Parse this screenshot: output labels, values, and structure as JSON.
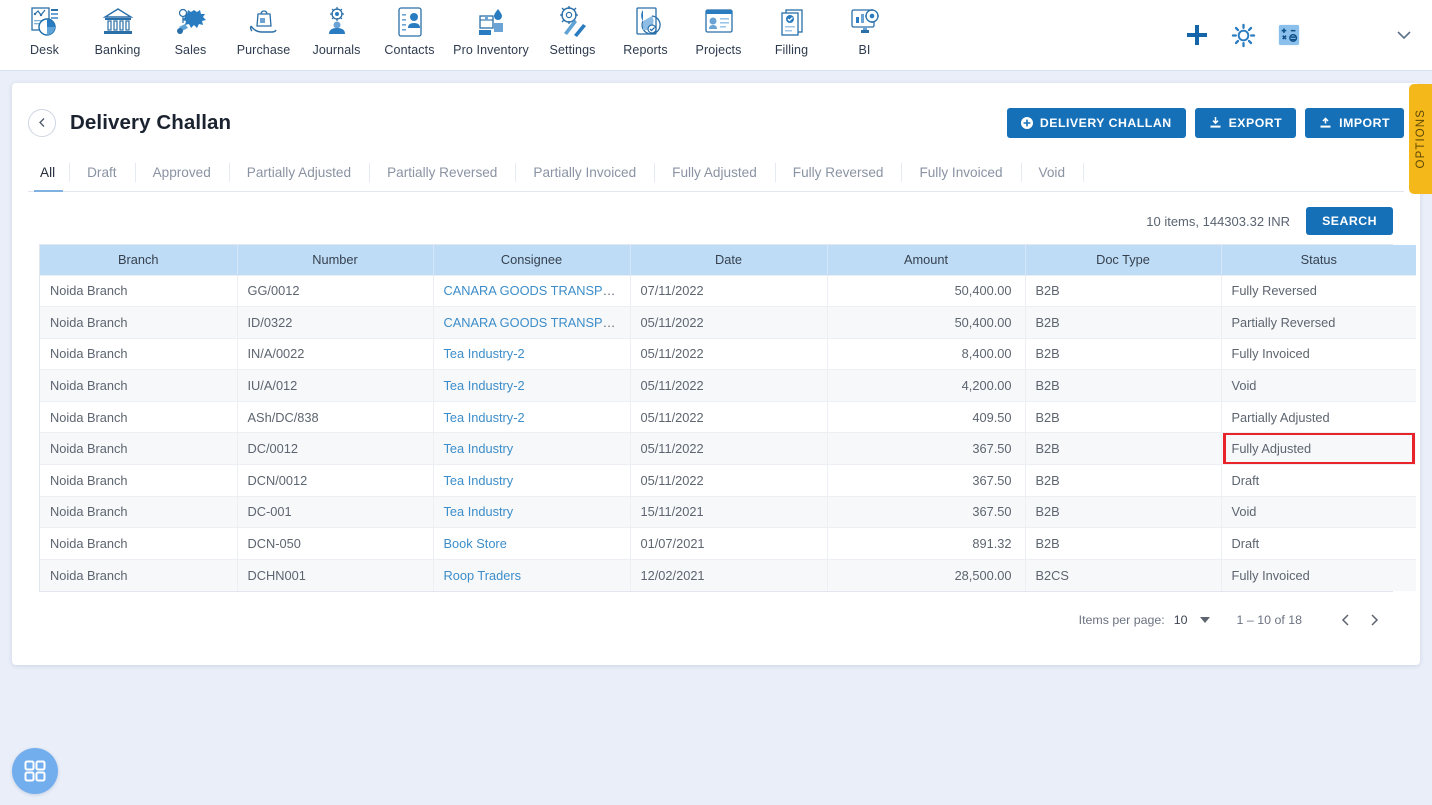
{
  "topnav": {
    "items": [
      {
        "label": "Desk",
        "icon": "desk-dashboard-icon"
      },
      {
        "label": "Banking",
        "icon": "bank-icon"
      },
      {
        "label": "Sales",
        "icon": "sales-icon"
      },
      {
        "label": "Purchase",
        "icon": "purchase-icon"
      },
      {
        "label": "Journals",
        "icon": "journals-icon"
      },
      {
        "label": "Contacts",
        "icon": "contacts-icon"
      },
      {
        "label": "Pro Inventory",
        "icon": "inventory-icon"
      },
      {
        "label": "Settings",
        "icon": "settings-tools-icon"
      },
      {
        "label": "Reports",
        "icon": "reports-piechart-icon"
      },
      {
        "label": "Projects",
        "icon": "projects-icon"
      },
      {
        "label": "Filling",
        "icon": "filling-documents-icon"
      },
      {
        "label": "BI",
        "icon": "bi-monitor-icon"
      }
    ],
    "actions": [
      {
        "name": "add-icon"
      },
      {
        "name": "gear-icon"
      },
      {
        "name": "calculator-icon"
      },
      {
        "name": "chevron-down-icon"
      }
    ]
  },
  "header": {
    "back_label": "‹",
    "title": "Delivery Challan",
    "buttons": [
      {
        "label": "DELIVERY CHALLAN",
        "icon": "plus-circle-icon"
      },
      {
        "label": "EXPORT",
        "icon": "export-download-icon"
      },
      {
        "label": "IMPORT",
        "icon": "import-upload-icon"
      }
    ]
  },
  "tabs": [
    {
      "label": "All",
      "active": true
    },
    {
      "label": "Draft",
      "active": false
    },
    {
      "label": "Approved",
      "active": false
    },
    {
      "label": "Partially Adjusted",
      "active": false
    },
    {
      "label": "Partially Reversed",
      "active": false
    },
    {
      "label": "Partially Invoiced",
      "active": false
    },
    {
      "label": "Fully Adjusted",
      "active": false
    },
    {
      "label": "Fully Reversed",
      "active": false
    },
    {
      "label": "Fully Invoiced",
      "active": false
    },
    {
      "label": "Void",
      "active": false
    }
  ],
  "searchbar": {
    "summary": "10 items, 144303.32 INR",
    "search_label": "SEARCH"
  },
  "table": {
    "columns": [
      "Branch",
      "Number",
      "Consignee",
      "Date",
      "Amount",
      "Doc Type",
      "Status"
    ],
    "rows": [
      {
        "branch": "Noida Branch",
        "number": "GG/0012",
        "consignee": "CANARA GOODS TRANSPORT",
        "date": "07/11/2022",
        "amount": "50,400.00",
        "doc_type": "B2B",
        "status": "Fully Reversed",
        "highlighted": false
      },
      {
        "branch": "Noida Branch",
        "number": "ID/0322",
        "consignee": "CANARA GOODS TRANSPORT",
        "date": "05/11/2022",
        "amount": "50,400.00",
        "doc_type": "B2B",
        "status": "Partially Reversed",
        "highlighted": false
      },
      {
        "branch": "Noida Branch",
        "number": "IN/A/0022",
        "consignee": "Tea Industry-2",
        "date": "05/11/2022",
        "amount": "8,400.00",
        "doc_type": "B2B",
        "status": "Fully Invoiced",
        "highlighted": false
      },
      {
        "branch": "Noida Branch",
        "number": "IU/A/012",
        "consignee": "Tea Industry-2",
        "date": "05/11/2022",
        "amount": "4,200.00",
        "doc_type": "B2B",
        "status": "Void",
        "highlighted": false
      },
      {
        "branch": "Noida Branch",
        "number": "ASh/DC/838",
        "consignee": "Tea Industry-2",
        "date": "05/11/2022",
        "amount": "409.50",
        "doc_type": "B2B",
        "status": "Partially Adjusted",
        "highlighted": false
      },
      {
        "branch": "Noida Branch",
        "number": "DC/0012",
        "consignee": "Tea Industry",
        "date": "05/11/2022",
        "amount": "367.50",
        "doc_type": "B2B",
        "status": "Fully Adjusted",
        "highlighted": true
      },
      {
        "branch": "Noida Branch",
        "number": "DCN/0012",
        "consignee": "Tea Industry",
        "date": "05/11/2022",
        "amount": "367.50",
        "doc_type": "B2B",
        "status": "Draft",
        "highlighted": false
      },
      {
        "branch": "Noida Branch",
        "number": "DC-001",
        "consignee": "Tea Industry",
        "date": "15/11/2021",
        "amount": "367.50",
        "doc_type": "B2B",
        "status": "Void",
        "highlighted": false
      },
      {
        "branch": "Noida Branch",
        "number": "DCN-050",
        "consignee": "Book Store",
        "date": "01/07/2021",
        "amount": "891.32",
        "doc_type": "B2B",
        "status": "Draft",
        "highlighted": false
      },
      {
        "branch": "Noida Branch",
        "number": "DCHN001",
        "consignee": "Roop Traders",
        "date": "12/02/2021",
        "amount": "28,500.00",
        "doc_type": "B2CS",
        "status": "Fully Invoiced",
        "highlighted": false
      }
    ]
  },
  "paginator": {
    "items_per_page_label": "Items per page:",
    "items_per_page_value": "10",
    "range_label": "1 – 10 of 18",
    "prev_label": "‹",
    "next_label": "›"
  },
  "options_tab": {
    "label": "OPTIONS"
  },
  "fab": {
    "icon": "grid-apps-icon"
  },
  "colors": {
    "accent_blue": "#1570b8",
    "link_blue": "#3c8dc9",
    "header_blue": "#bedcf5",
    "highlight_red": "#e8232a",
    "options_yellow": "#f5b81a",
    "page_bg": "#e9eef8"
  }
}
